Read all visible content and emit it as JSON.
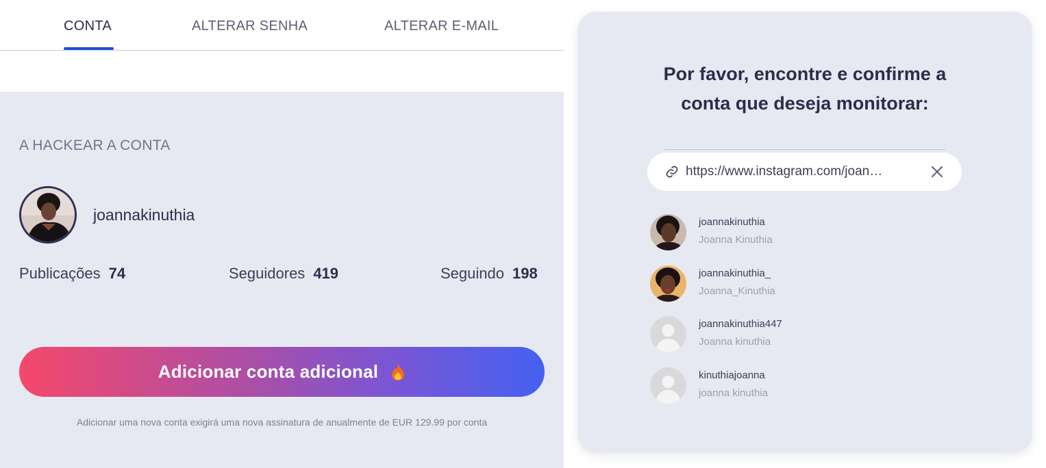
{
  "tabs": [
    {
      "label": "CONTA",
      "active": true
    },
    {
      "label": "ALTERAR SENHA",
      "active": false
    },
    {
      "label": "ALTERAR E-MAIL",
      "active": false
    }
  ],
  "account": {
    "section_title": "A HACKEAR A CONTA",
    "username": "joannakinuthia",
    "stats": [
      {
        "label": "Publicações",
        "value": "74"
      },
      {
        "label": "Seguidores",
        "value": "419"
      },
      {
        "label": "Seguindo",
        "value": "198"
      }
    ],
    "add_button_label": "Adicionar conta adicional",
    "add_button_icon": "flame-icon",
    "note": "Adicionar uma nova conta exigirá uma nova assinatura de anualmente de EUR 129.99 por conta"
  },
  "search_card": {
    "title_line1": "Por favor, encontre e confirme a",
    "title_line2": "conta que deseja monitorar:",
    "search_value": "https://www.instagram.com/joannakinuthia/",
    "results": [
      {
        "username": "joannakinuthia",
        "name": "Joanna Kinuthia",
        "avatar": "photo"
      },
      {
        "username": "joannakinuthia_",
        "name": "Joanna_Kinuthia",
        "avatar": "photo"
      },
      {
        "username": "joannakinuthia447",
        "name": "Joanna kinuthia",
        "avatar": "default"
      },
      {
        "username": "kinuthiajoanna",
        "name": "joanna kinuthia",
        "avatar": "default"
      }
    ]
  },
  "colors": {
    "accent": "#1d4fd8",
    "panel_bg": "#e7e9f2",
    "gradient_start": "#f5486b",
    "gradient_end": "#4561f0"
  }
}
